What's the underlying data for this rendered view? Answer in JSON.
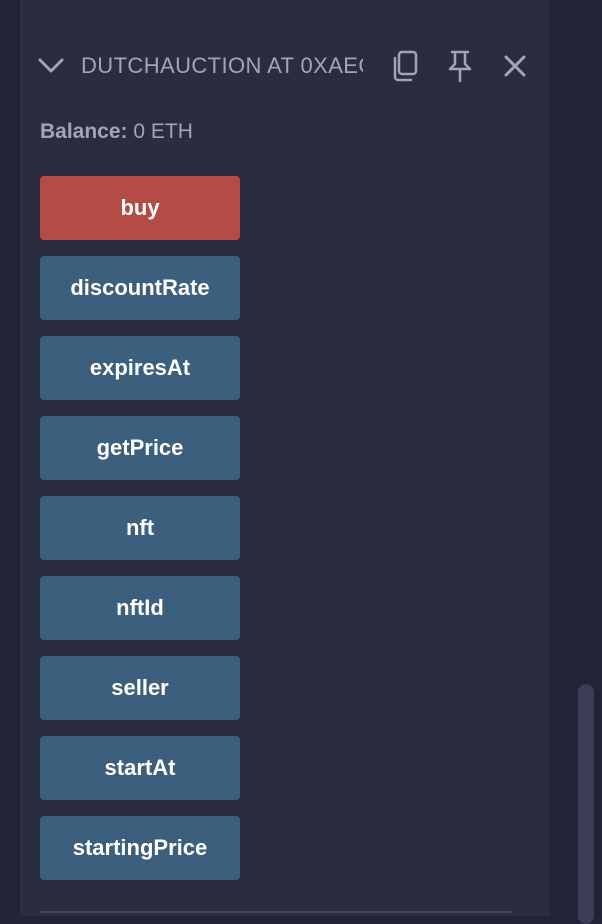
{
  "contract": {
    "title": "DUTCHAUCTION AT 0XAEC",
    "icons": {
      "collapse": "chevron-down-icon",
      "copy": "copy-icon",
      "pin": "pin-icon",
      "close": "close-icon"
    }
  },
  "balance": {
    "label": "Balance:",
    "value": "0 ETH"
  },
  "functions": [
    {
      "label": "buy",
      "kind": "payable"
    },
    {
      "label": "discountRate",
      "kind": "call"
    },
    {
      "label": "expiresAt",
      "kind": "call"
    },
    {
      "label": "getPrice",
      "kind": "call"
    },
    {
      "label": "nft",
      "kind": "call"
    },
    {
      "label": "nftId",
      "kind": "call"
    },
    {
      "label": "seller",
      "kind": "call"
    },
    {
      "label": "startAt",
      "kind": "call"
    },
    {
      "label": "startingPrice",
      "kind": "call"
    }
  ],
  "colors": {
    "payable_button": "#b34c44",
    "call_button": "#3c5f7e",
    "panel_bg": "#2a2c3f",
    "text_muted": "#a2a3bd"
  }
}
